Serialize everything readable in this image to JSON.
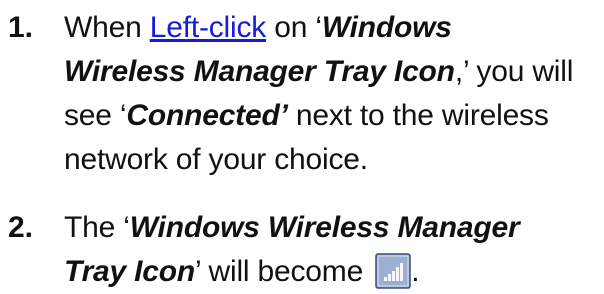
{
  "steps": [
    {
      "number": "1.",
      "segments": {
        "s1": "When ",
        "s2": "Left-click",
        "s3": " on ‘",
        "s4": "Windows",
        "s5": "Wireless Manager Tray Icon",
        "s6": ",’ you will",
        "s7": "see ‘",
        "s8": "Connected’",
        "s9": " next to the wireless",
        "s10": "network of your choice."
      }
    },
    {
      "number": "2.",
      "segments": {
        "s1": "The ‘",
        "s2": "Windows Wireless Manager",
        "s3": "Tray Icon",
        "s4": "’ will become ",
        "s5": "."
      }
    }
  ],
  "icons": {
    "tray_icon": "wireless-signal-icon"
  },
  "colors": {
    "link": "#1a1adb",
    "text": "#111111",
    "icon_background": "#9db0cf",
    "icon_border": "#3a4f7a"
  }
}
